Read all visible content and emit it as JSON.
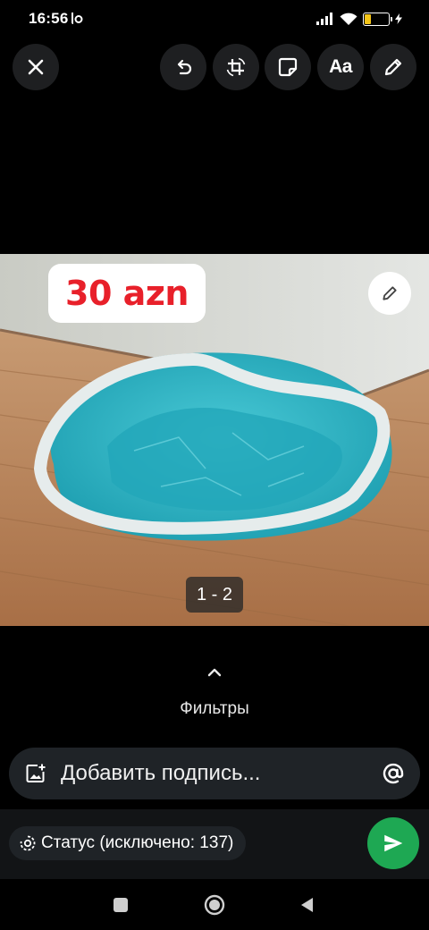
{
  "status_bar": {
    "time": "16:56",
    "battery_level": "25",
    "icons": [
      "app-notification-icon",
      "signal-icon",
      "wifi-icon",
      "battery-icon",
      "charging-icon"
    ]
  },
  "toolbar": {
    "buttons": [
      "close-icon",
      "undo-icon",
      "crop-rotate-icon",
      "sticker-icon",
      "text-icon",
      "pencil-icon"
    ],
    "text_tool_label": "Aa"
  },
  "photo": {
    "price_sticker": "30 azn",
    "page_indicator": "1 - 2",
    "colors": {
      "wall": "#d9dcd8",
      "floor": "#b9835a",
      "pool": "#2fb7c8",
      "rim": "#e6ecec"
    }
  },
  "filters": {
    "label": "Фильтры"
  },
  "caption": {
    "placeholder": "Добавить подпись..."
  },
  "footer": {
    "status_label": "Статус (исключено: 137)",
    "send_color": "#1ea853"
  }
}
